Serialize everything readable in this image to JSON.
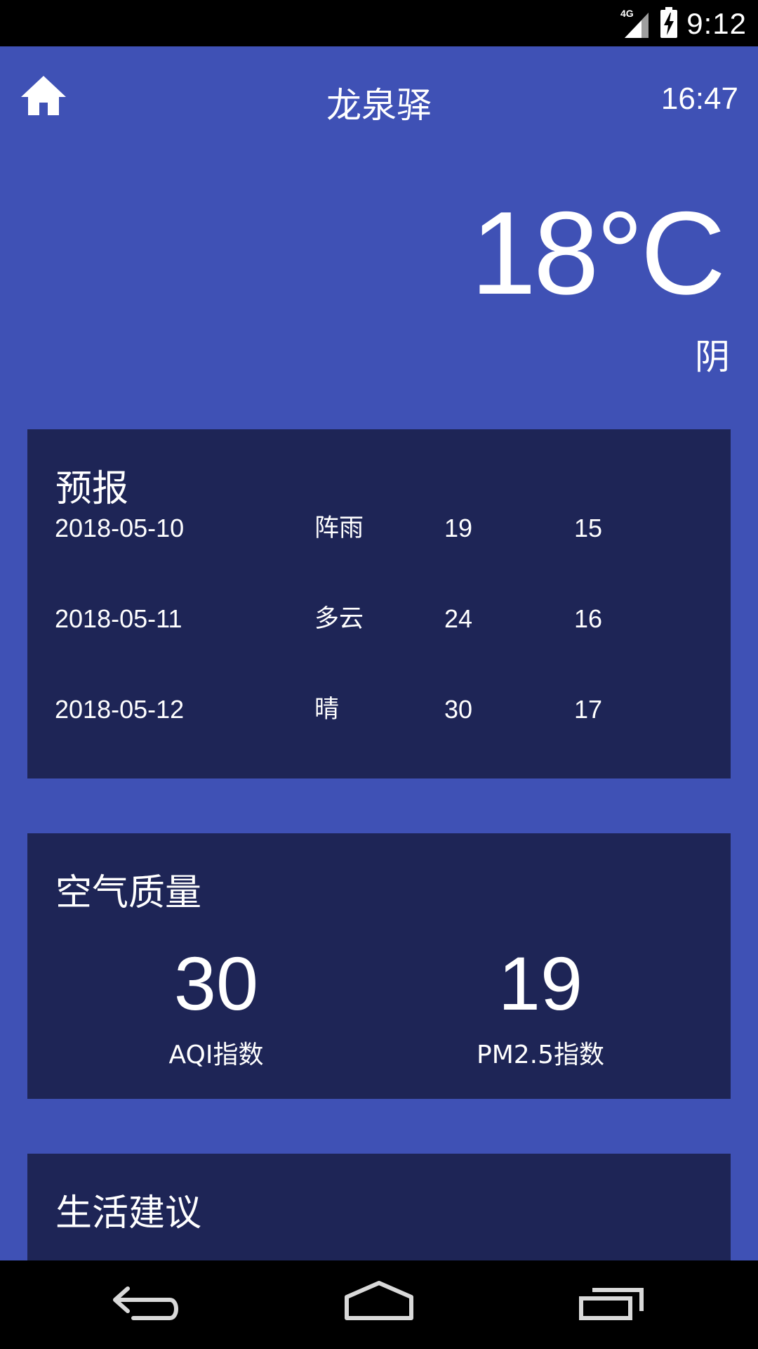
{
  "status_bar": {
    "network": "4G",
    "time": "9:12"
  },
  "header": {
    "city": "龙泉驿",
    "update_time": "16:47",
    "home_icon": "home-icon"
  },
  "now": {
    "temperature": "18°C",
    "condition": "阴"
  },
  "forecast": {
    "title": "预报",
    "rows": [
      {
        "date": "2018-05-10",
        "info": "阵雨",
        "max": "19",
        "min": "15"
      },
      {
        "date": "2018-05-11",
        "info": "多云",
        "max": "24",
        "min": "16"
      },
      {
        "date": "2018-05-12",
        "info": "晴",
        "max": "30",
        "min": "17"
      }
    ]
  },
  "aqi": {
    "title": "空气质量",
    "aqi_value": "30",
    "aqi_label": "AQI指数",
    "pm25_value": "19",
    "pm25_label": "PM2.5指数"
  },
  "suggestion": {
    "title": "生活建议"
  },
  "nav": {
    "back_icon": "back-icon",
    "home_icon": "home-outline-icon",
    "recents_icon": "recents-icon"
  },
  "colors": {
    "primary": "#3f51b5",
    "card": "#1e2556",
    "text": "#ffffff"
  }
}
